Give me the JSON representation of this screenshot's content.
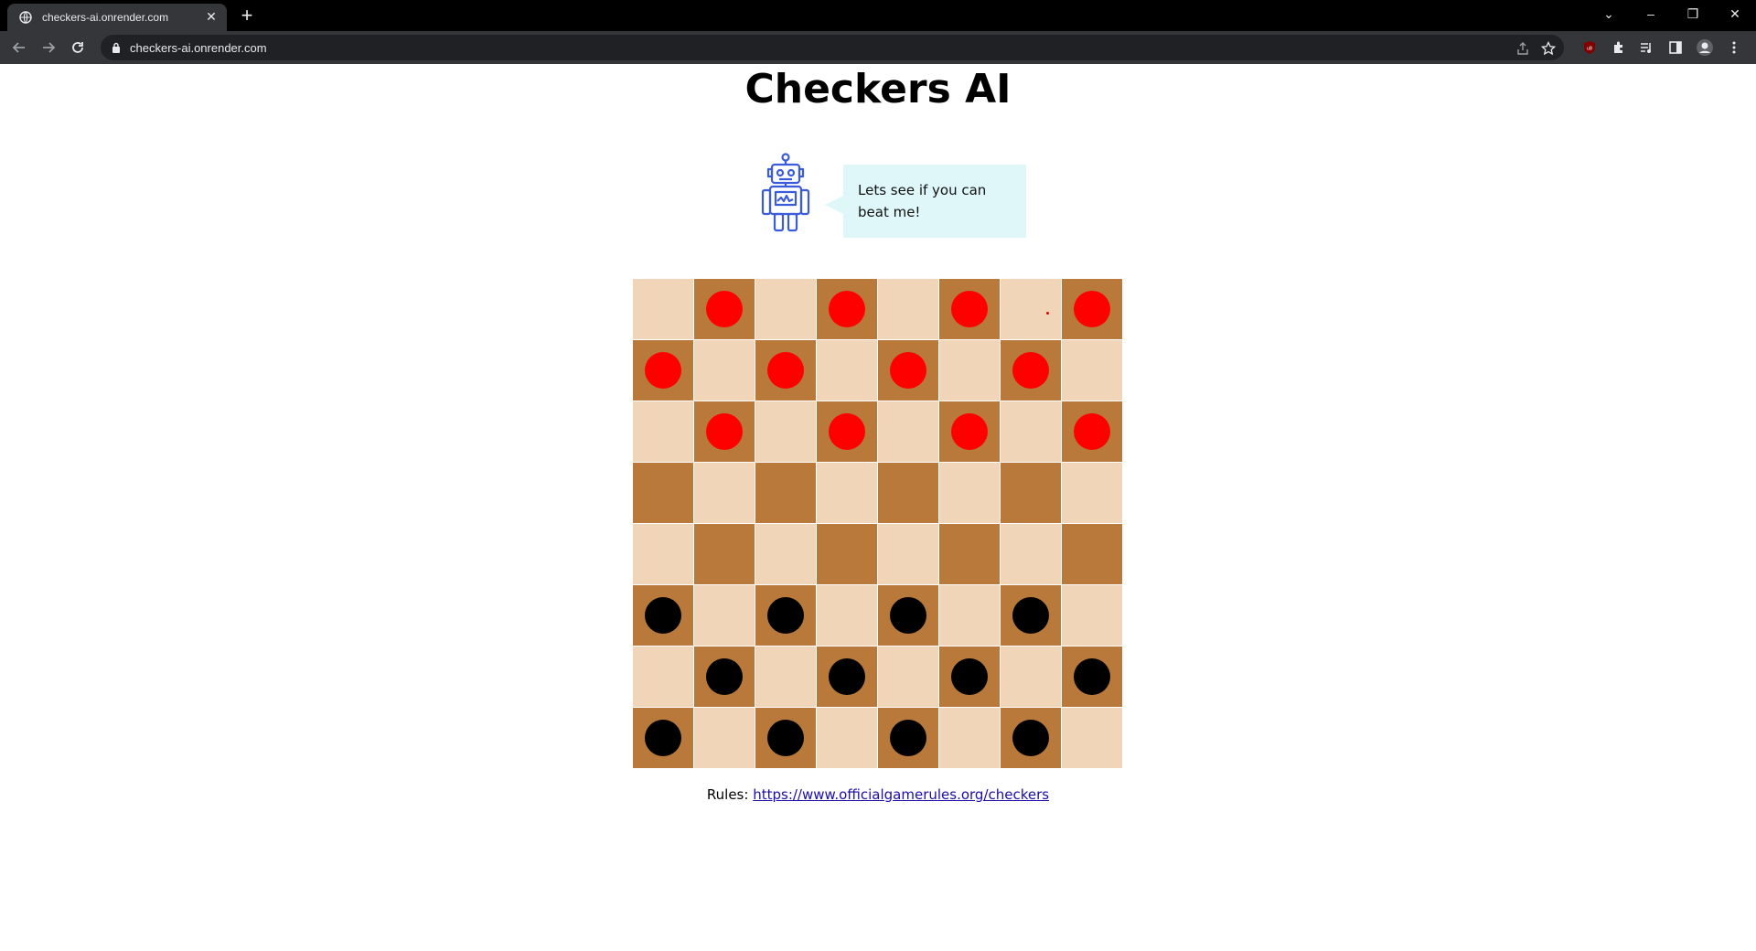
{
  "browser": {
    "tab_title": "checkers-ai.onrender.com",
    "tab_close": "✕",
    "new_tab": "+",
    "url": "checkers-ai.onrender.com",
    "window_controls": {
      "dropdown": "⌄",
      "minimize": "–",
      "restore": "❐",
      "close": "✕"
    },
    "extension_badge": "uB"
  },
  "page": {
    "title": "Checkers AI",
    "speech": "Lets see if you can beat me!",
    "rules_label": "Rules:",
    "rules_link": "https://www.officialgamerules.org/checkers"
  },
  "board": {
    "size": 8,
    "colors": {
      "light": "#f0d5b8",
      "dark": "#b8793a",
      "red": "#ff0000",
      "black": "#000000",
      "bubble": "#e0f7fa",
      "robot": "#3b5bdb"
    },
    "rows": [
      [
        "",
        "r",
        "",
        "r",
        "",
        "r",
        "",
        "r"
      ],
      [
        "r",
        "",
        "r",
        "",
        "r",
        "",
        "r",
        ""
      ],
      [
        "",
        "r",
        "",
        "r",
        "",
        "r",
        "",
        "r"
      ],
      [
        "",
        "",
        "",
        "",
        "",
        "",
        "",
        ""
      ],
      [
        "",
        "",
        "",
        "",
        "",
        "",
        "",
        ""
      ],
      [
        "b",
        "",
        "b",
        "",
        "b",
        "",
        "b",
        ""
      ],
      [
        "",
        "b",
        "",
        "b",
        "",
        "b",
        "",
        "b"
      ],
      [
        "b",
        "",
        "b",
        "",
        "b",
        "",
        "b",
        ""
      ]
    ]
  }
}
